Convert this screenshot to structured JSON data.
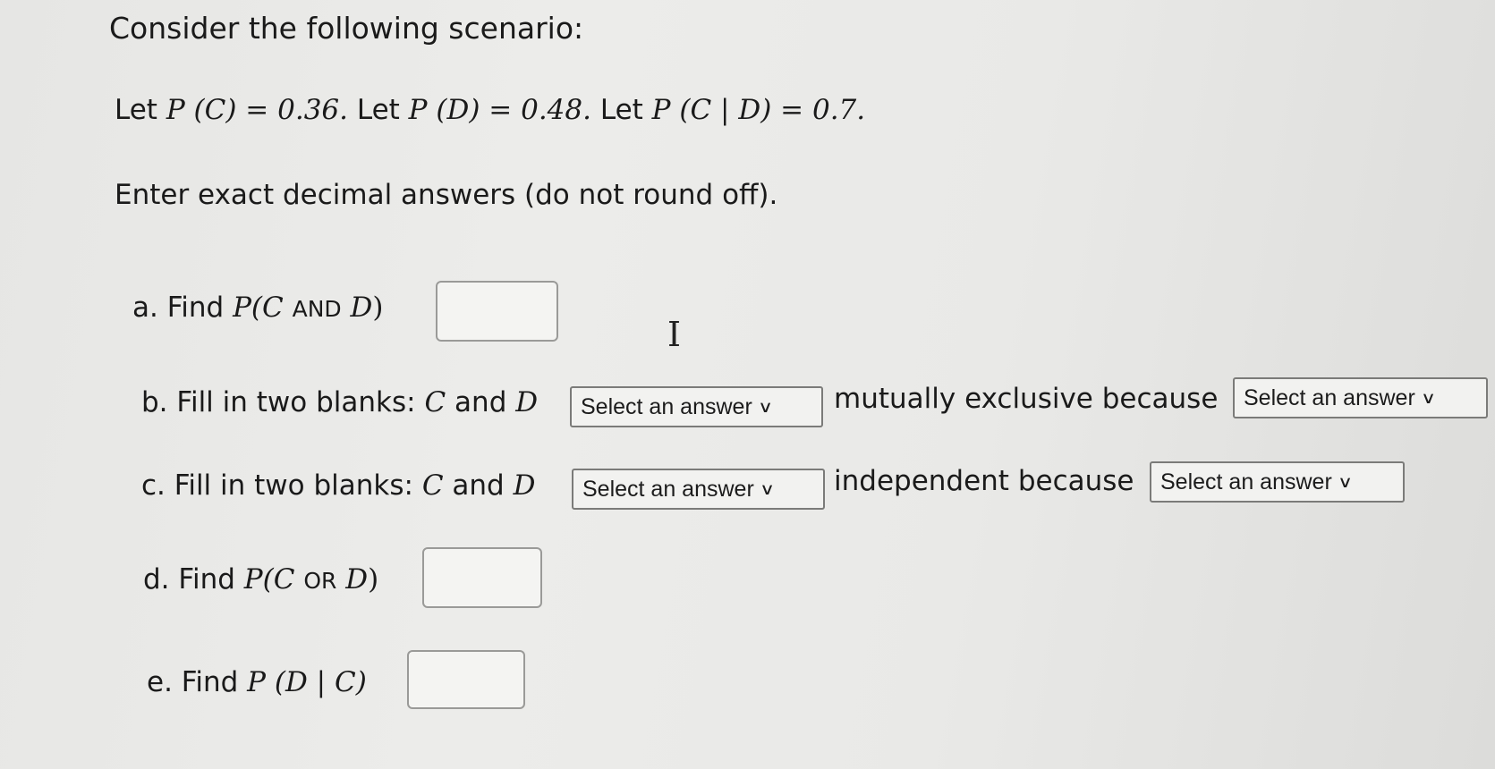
{
  "header": {
    "title": "Consider the following scenario:",
    "given": {
      "let1": "Let",
      "pc": "P (C) = 0.36.",
      "let2": "Let",
      "pd": "P (D) = 0.48.",
      "let3": "Let",
      "pcd": "P (C | D) = 0.7."
    },
    "instruction": "Enter exact decimal answers (do not round off)."
  },
  "questions": {
    "a": {
      "label": "a. Find",
      "expr_p": "P(",
      "expr_c": "C",
      "expr_op": "AND",
      "expr_d": "D",
      "expr_close": ")",
      "value": ""
    },
    "b": {
      "label": "b. Fill in two blanks:",
      "c": "C",
      "and": "and",
      "d": "D",
      "select1": "Select an answer",
      "middle": "mutually exclusive because",
      "select2": "Select an answer"
    },
    "c": {
      "label": "c. Fill in two blanks:",
      "c": "C",
      "and": "and",
      "d": "D",
      "select1": "Select an answer",
      "middle": "independent because",
      "select2": "Select an answer"
    },
    "d": {
      "label": "d. Find",
      "expr_p": "P(",
      "expr_c": "C",
      "expr_op": "OR",
      "expr_d": "D",
      "expr_close": ")",
      "value": ""
    },
    "e": {
      "label": "e. Find",
      "expr": "P (D | C)",
      "value": ""
    }
  },
  "icons": {
    "chevron": "∨",
    "cursor": "I"
  }
}
